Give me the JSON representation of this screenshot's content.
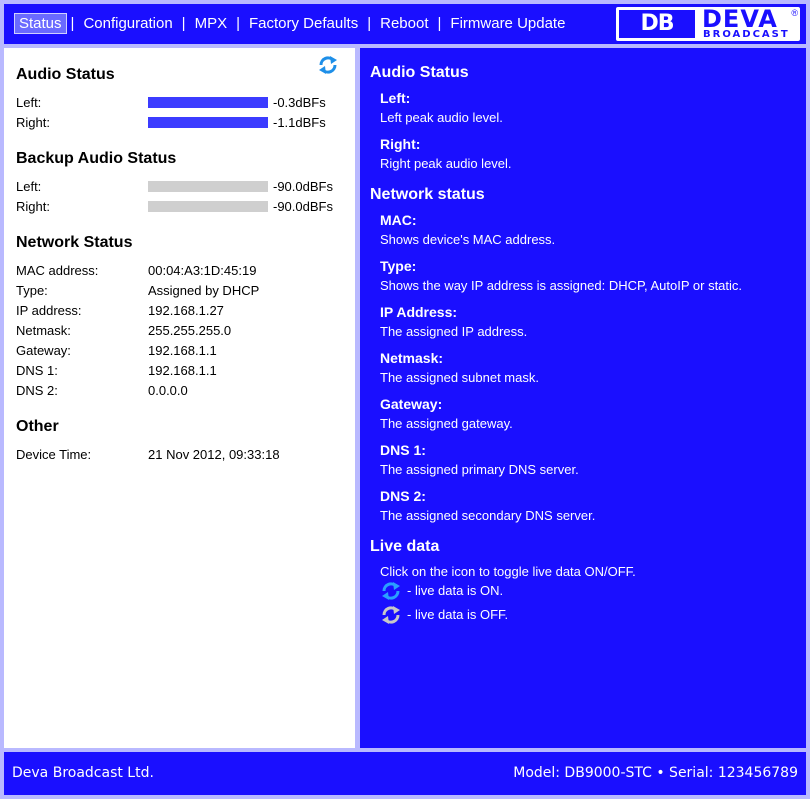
{
  "nav": {
    "items": [
      "Status",
      "Configuration",
      "MPX",
      "Factory Defaults",
      "Reboot",
      "Firmware Update"
    ],
    "separator": "|",
    "active": "Status"
  },
  "logo": {
    "mark": "DB",
    "brand": "DEVA",
    "registered": "®",
    "sub": "BROADCAST"
  },
  "left": {
    "refresh_icon": "refresh-icon",
    "audio_status": {
      "title": "Audio Status",
      "left_label": "Left:",
      "left_value": "-0.3dBFs",
      "left_level": 1.0,
      "right_label": "Right:",
      "right_value": "-1.1dBFs",
      "right_level": 1.0
    },
    "backup_audio_status": {
      "title": "Backup Audio Status",
      "left_label": "Left:",
      "left_value": "-90.0dBFs",
      "right_label": "Right:",
      "right_value": "-90.0dBFs"
    },
    "network_status": {
      "title": "Network Status",
      "rows": [
        {
          "label": "MAC address:",
          "value": "00:04:A3:1D:45:19"
        },
        {
          "label": "Type:",
          "value": "Assigned by DHCP"
        },
        {
          "label": "IP address:",
          "value": "192.168.1.27"
        },
        {
          "label": "Netmask:",
          "value": "255.255.255.0"
        },
        {
          "label": "Gateway:",
          "value": "192.168.1.1"
        },
        {
          "label": "DNS 1:",
          "value": "192.168.1.1"
        },
        {
          "label": "DNS 2:",
          "value": "0.0.0.0"
        }
      ]
    },
    "other": {
      "title": "Other",
      "device_time_label": "Device Time:",
      "device_time_value": "21 Nov 2012, 09:33:18"
    }
  },
  "help": {
    "audio_title": "Audio Status",
    "left_term": "Left:",
    "left_desc": "Left peak audio level.",
    "right_term": "Right:",
    "right_desc": "Right peak audio level.",
    "network_title": "Network status",
    "mac_term": "MAC:",
    "mac_desc": "Shows device's MAC address.",
    "type_term": "Type:",
    "type_desc": "Shows the way IP address is assigned: DHCP, AutoIP or static.",
    "ip_term": "IP Address:",
    "ip_desc": "The assigned IP address.",
    "netmask_term": "Netmask:",
    "netmask_desc": "The assigned subnet mask.",
    "gateway_term": "Gateway:",
    "gateway_desc": "The assigned gateway.",
    "dns1_term": "DNS 1:",
    "dns1_desc": "The assigned primary DNS server.",
    "dns2_term": "DNS 2:",
    "dns2_desc": "The assigned secondary DNS server.",
    "live_title": "Live data",
    "live_desc": "Click on the icon to toggle live data ON/OFF.",
    "live_on": "- live data is ON.",
    "live_off": "- live data is OFF."
  },
  "footer": {
    "company": "Deva Broadcast Ltd.",
    "model": "Model: DB9000-STC • Serial: 123456789"
  },
  "colors": {
    "accent": "#1a0fff",
    "bar_active": "#3c3cff",
    "bar_inactive": "#cfcfcf",
    "frame": "#b9b9ff"
  }
}
